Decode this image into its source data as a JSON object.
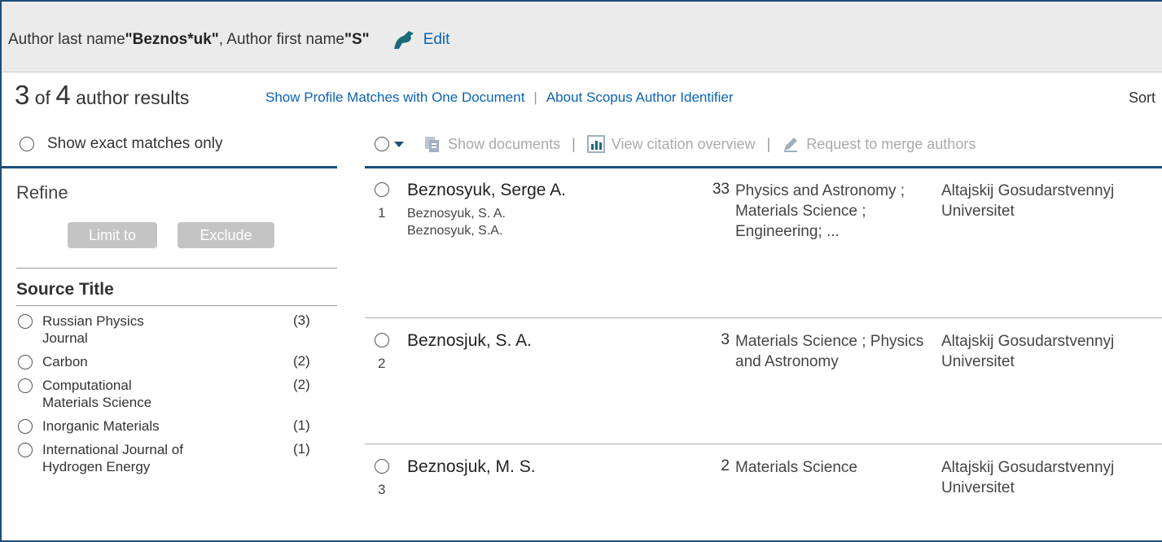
{
  "query": {
    "prefix1": "Author last name ",
    "last_name": "\"Beznos*uk\"",
    "middle": " , Author first name ",
    "first_name": "\"S\"",
    "edit_label": "Edit"
  },
  "results_header": {
    "shown": "3",
    "of": " of ",
    "total": "4",
    "suffix": " author results",
    "link_profile_matches": "Show Profile Matches with One Document",
    "separator": "|",
    "link_about": "About Scopus Author Identifier",
    "sort_label": "Sort"
  },
  "left_panel": {
    "exact_matches_label": "Show exact matches only",
    "refine_title": "Refine",
    "limit_to_label": "Limit to",
    "exclude_label": "Exclude",
    "source_title_heading": "Source Title",
    "sources": [
      {
        "name": "Russian Physics Journal",
        "count": "(3)"
      },
      {
        "name": "Carbon",
        "count": "(2)"
      },
      {
        "name": "Computational Materials Science",
        "count": "(2)"
      },
      {
        "name": "Inorganic Materials",
        "count": "(1)"
      },
      {
        "name": "International Journal of Hydrogen Energy",
        "count": "(1)"
      }
    ]
  },
  "toolbar": {
    "show_documents": "Show documents",
    "view_citation_overview": "View citation overview",
    "request_merge": "Request to merge authors",
    "separator": "|"
  },
  "results": [
    {
      "num": "1",
      "name": "Beznosyuk, Serge A.",
      "variants": [
        "Beznosyuk, S. A.",
        "Beznosyuk, S.A."
      ],
      "documents": "33",
      "subject": "Physics and Astronomy ; Materials Science ; Engineering; ...",
      "affiliation": "Altajskij Gosudarstvennyj Universitet"
    },
    {
      "num": "2",
      "name": "Beznosjuk, S. A.",
      "variants": [],
      "documents": "3",
      "subject": "Materials Science ; Physics and Astronomy",
      "affiliation": "Altajskij Gosudarstvennyj Universitet"
    },
    {
      "num": "3",
      "name": "Beznosjuk, M. S.",
      "variants": [],
      "documents": "2",
      "subject": "Materials Science",
      "affiliation": "Altajskij Gosudarstvennyj Universitet"
    }
  ],
  "colors": {
    "link": "#0b63b5",
    "rule": "#1f4e79",
    "edit_icon": "#1a6b7a",
    "disabled_button": "#c4c4c4"
  }
}
